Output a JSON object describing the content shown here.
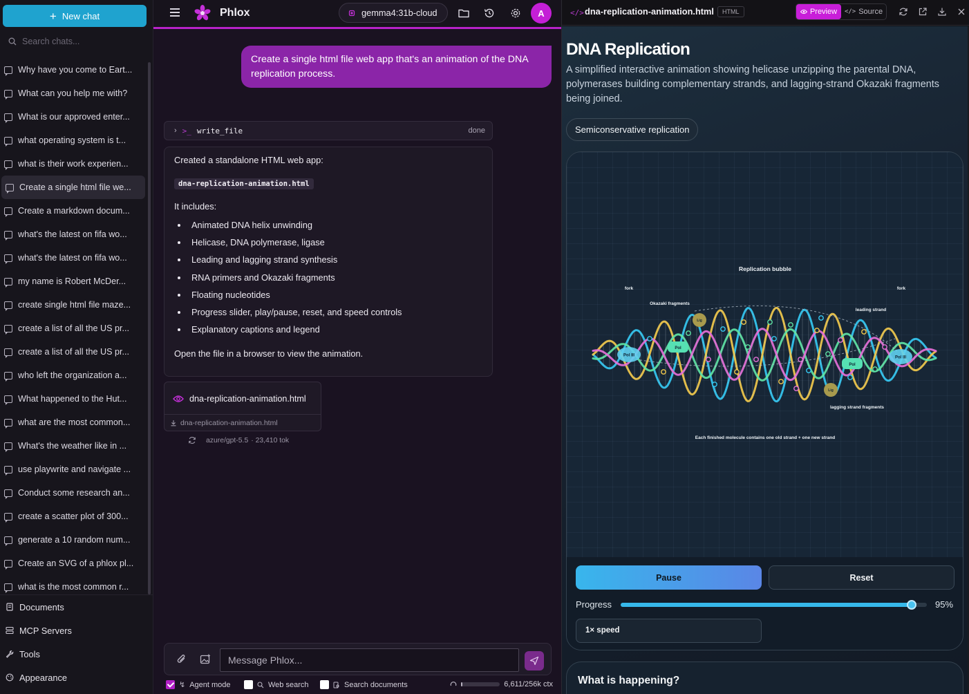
{
  "sidebar": {
    "new_chat": "New chat",
    "search_placeholder": "Search chats...",
    "chats": [
      "Why have you come to Eart...",
      "What can you help me with?",
      "What is our approved enter...",
      "what operating system is t...",
      "what is their work experien...",
      "Create a single html file we...",
      "Create a markdown docum...",
      "what's the latest on fifa wo...",
      "what's the latest on fifa wo...",
      "my name is Robert McDer...",
      "create single html file maze...",
      "create a list of all the US pr...",
      "create a list of all the US pr...",
      "who left the organization a...",
      "What happened to the Hut...",
      "what are the most common...",
      "What's the weather like in ...",
      "use playwrite and navigate ...",
      "Conduct some research an...",
      "create a scatter plot of 300...",
      "generate a 10 random num...",
      "Create an SVG of a phlox pl...",
      "what is the most common r..."
    ],
    "active_index": 5,
    "footer": [
      "Documents",
      "MCP Servers",
      "Tools",
      "Appearance"
    ]
  },
  "header": {
    "brand": "Phlox",
    "model": "gemma4:31b-cloud",
    "avatar_initial": "A",
    "accent": "#b722c9"
  },
  "conversation": {
    "user_message": "Create a single html file web app that's an animation of the DNA replication process.",
    "tool_name": "write_file",
    "tool_status": "done",
    "reply_intro": "Created a standalone HTML web app:",
    "filename": "dna-replication-animation.html",
    "includes_label": "It includes:",
    "bullets": [
      "Animated DNA helix unwinding",
      "Helicase, DNA polymerase, ligase",
      "Leading and lagging strand synthesis",
      "RNA primers and Okazaki fragments",
      "Floating nucleotides",
      "Progress slider, play/pause, reset, and speed controls",
      "Explanatory captions and legend"
    ],
    "outro": "Open the file in a browser to view the animation.",
    "file_card_name": "dna-replication-animation.html",
    "file_card_download": "dna-replication-animation.html",
    "model_used": "azure/gpt-5.5",
    "tokens": "· 23,410 tok"
  },
  "composer": {
    "placeholder": "Message Phlox...",
    "agent_mode": "Agent mode",
    "agent_mode_checked": true,
    "web_search": "Web search",
    "web_search_checked": false,
    "search_documents": "Search documents",
    "search_documents_checked": false,
    "context": "6,611/256k ctx",
    "context_fraction": 0.026
  },
  "panel": {
    "filename": "dna-replication-animation.html",
    "badge": "HTML",
    "preview_tab": "Preview",
    "source_tab": "Source"
  },
  "page": {
    "title": "DNA Replication",
    "description": "A simplified interactive animation showing helicase unzipping the parental DNA, polymerases building complementary strands, and lagging-strand Okazaki fragments being joined.",
    "chip": "Semiconservative replication",
    "labels": {
      "bubble": "Replication bubble",
      "fork_left": "fork",
      "fork_right": "fork",
      "okazaki": "Okazaki fragments",
      "leading": "leading strand",
      "lagging": "lagging strand fragments",
      "caption": "Each finished molecule contains one old strand + one new strand",
      "pol_iii_left": "Pol III",
      "pol_iii_right": "Pol III",
      "pol_1": "Pol",
      "pol_2": "Pol",
      "lig_1": "Lig",
      "lig_2": "Lig"
    },
    "pause": "Pause",
    "reset": "Reset",
    "progress_label": "Progress",
    "progress_value": "95%",
    "progress_fraction": 0.95,
    "speed": "1× speed",
    "section_heading": "What is happening?",
    "strand_colors": [
      "#35c8f2",
      "#f2c94c",
      "#5fe3a5",
      "#e56fd8"
    ]
  }
}
